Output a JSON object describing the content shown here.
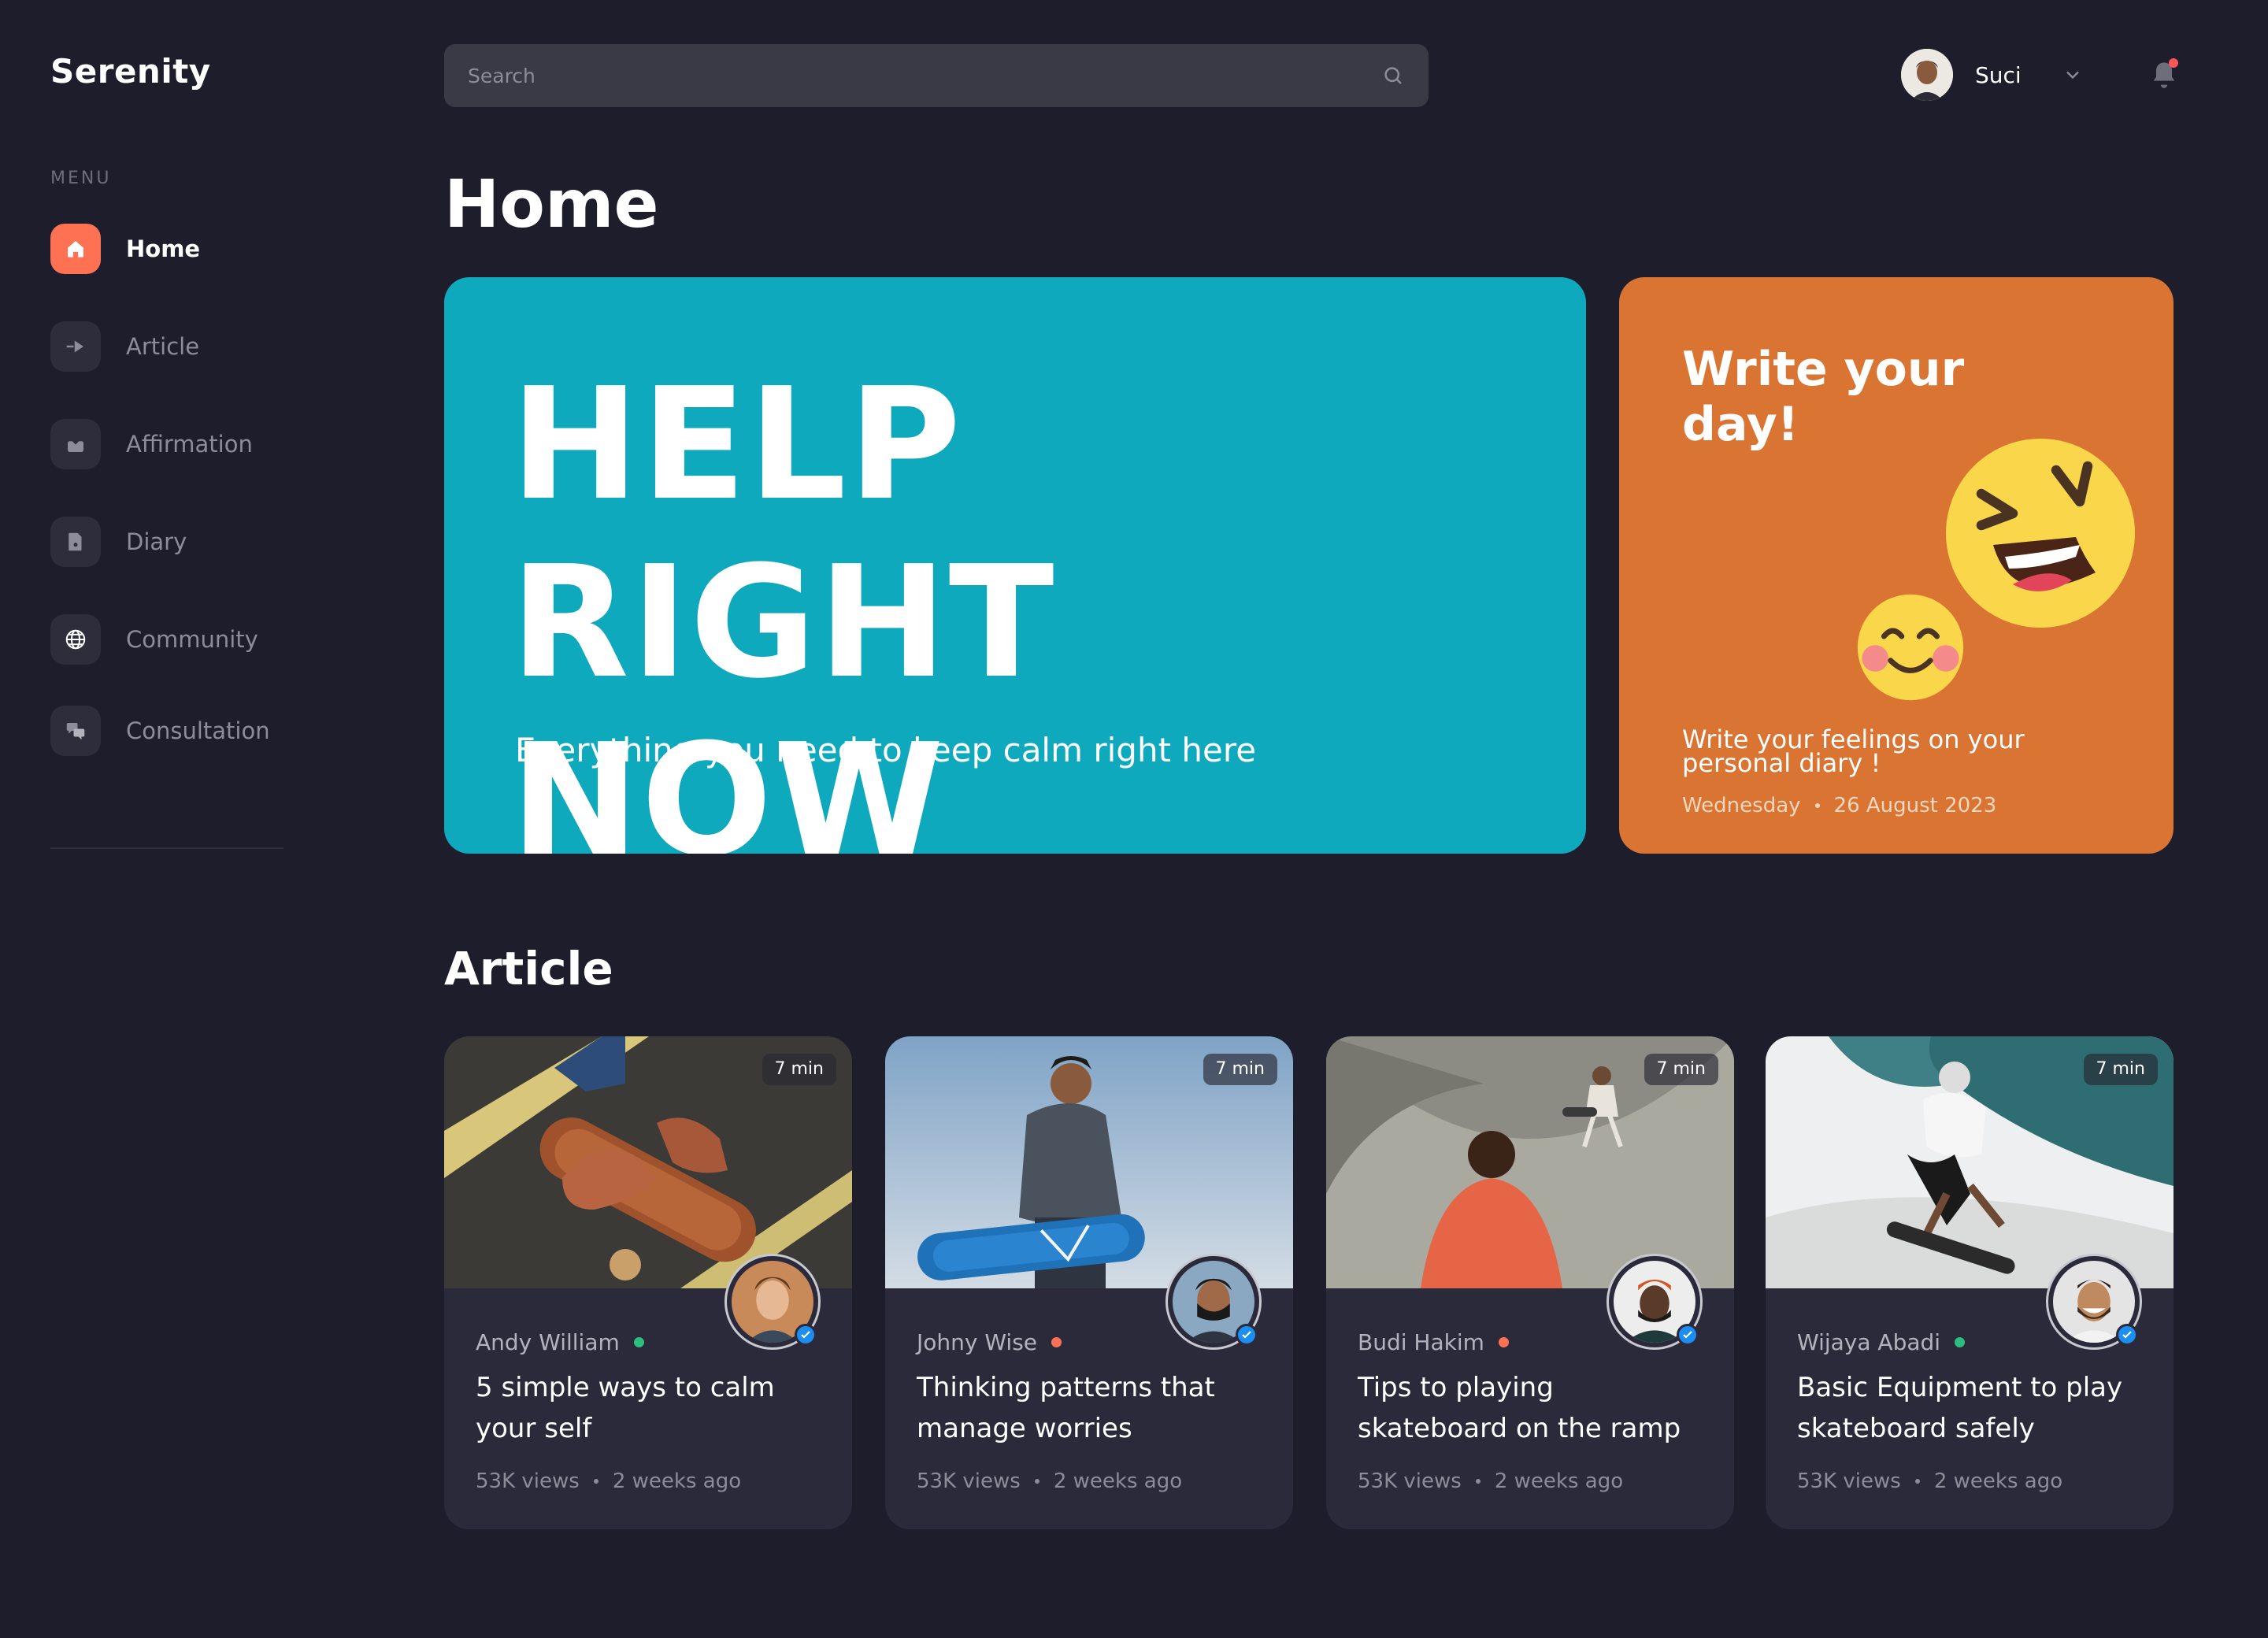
{
  "app": {
    "name": "Serenity"
  },
  "sidebar": {
    "menu_title": "MENU",
    "items": [
      {
        "label": "Home",
        "icon": "home-icon",
        "active": true
      },
      {
        "label": "Article",
        "icon": "article-icon",
        "active": false
      },
      {
        "label": "Affirmation",
        "icon": "affirmation-icon",
        "active": false
      },
      {
        "label": "Diary",
        "icon": "diary-icon",
        "active": false
      },
      {
        "label": "Community",
        "icon": "globe-icon",
        "active": false
      },
      {
        "label": "Consultation",
        "icon": "chat-icon",
        "active": false
      }
    ]
  },
  "header": {
    "search_placeholder": "Search",
    "user_name": "Suci"
  },
  "page": {
    "title": "Home"
  },
  "hero": {
    "title": "HELP RIGHT NOW",
    "subtitle": "Everything you need to keep calm right here"
  },
  "diary_card": {
    "title": "Write your day!",
    "text": "Write your feelings on your personal diary !",
    "day": "Wednesday",
    "date": "26 August 2023"
  },
  "articles_section": {
    "title": "Article",
    "cards": [
      {
        "duration": "7 min",
        "author": "Andy William",
        "status_color": "#2DBE7E",
        "title": "5 simple ways to calm your self",
        "views": "53K views",
        "time": "2 weeks ago"
      },
      {
        "duration": "7 min",
        "author": "Johny Wise",
        "status_color": "#FE7253",
        "title": "Thinking patterns that manage worries",
        "views": "53K views",
        "time": "2 weeks ago"
      },
      {
        "duration": "7 min",
        "author": "Budi Hakim",
        "status_color": "#FE7253",
        "title": "Tips to playing skateboard on the ramp",
        "views": "53K views",
        "time": "2 weeks ago"
      },
      {
        "duration": "7 min",
        "author": "Wijaya Abadi",
        "status_color": "#2DBE7E",
        "title": "Basic Equipment to play skateboard safely",
        "views": "53K views",
        "time": "2 weeks ago"
      }
    ]
  },
  "colors": {
    "background": "#1E1D2B",
    "accent": "#FE7253",
    "hero": "#0EA9BD",
    "diary": "#D97432",
    "card": "#2A2A3A"
  }
}
